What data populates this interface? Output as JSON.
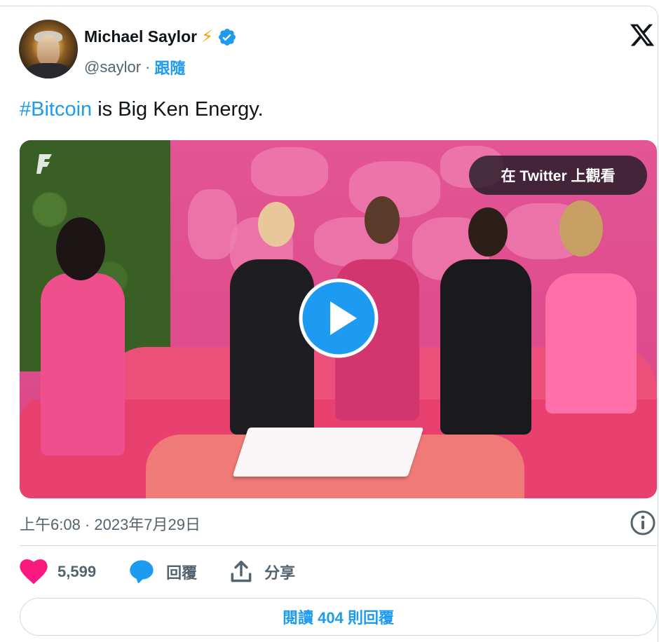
{
  "author": {
    "name": "Michael Saylor",
    "name_emoji": "⚡",
    "handle": "@saylor",
    "separator": "·",
    "follow_label": "跟隨"
  },
  "tweet": {
    "hashtag": "#Bitcoin",
    "text_rest": " is Big Ken Energy."
  },
  "media": {
    "watch_label": "在 Twitter 上觀看"
  },
  "meta": {
    "timestamp": "上午6:08 · 2023年7月29日"
  },
  "actions": {
    "like_count": "5,599",
    "reply_label": "回覆",
    "share_label": "分享"
  },
  "read_replies_label": "閱讀 404 則回覆",
  "colors": {
    "accent": "#1d9bf0",
    "like": "#f91880",
    "text_secondary": "#536471"
  }
}
